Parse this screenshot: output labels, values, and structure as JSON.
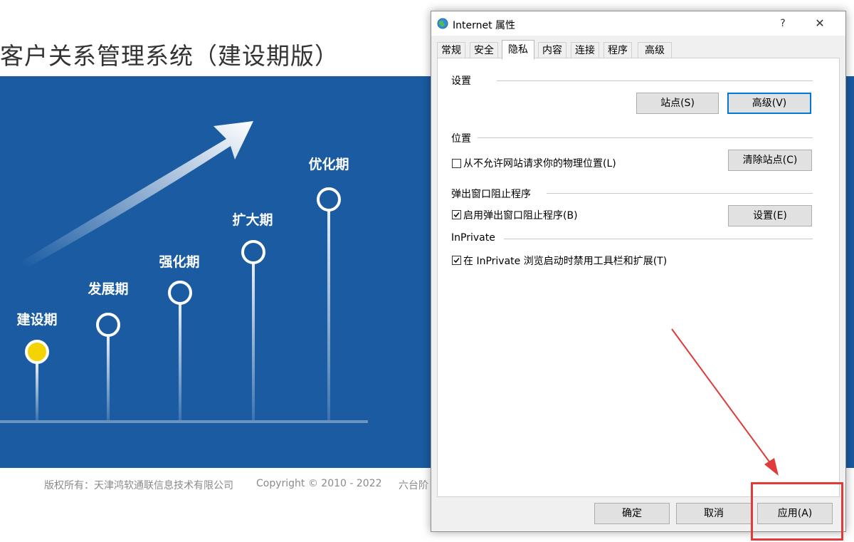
{
  "page": {
    "title": "客户关系管理系统（建设期版）",
    "stages": [
      {
        "label": "建设期",
        "current": true
      },
      {
        "label": "发展期",
        "current": false
      },
      {
        "label": "强化期",
        "current": false
      },
      {
        "label": "扩大期",
        "current": false
      },
      {
        "label": "优化期",
        "current": false
      }
    ],
    "footer": {
      "copyright_owner": "版权所有：天津鸿软通联信息技术有限公司",
      "copyright_years": "Copyright © 2010 - 2022",
      "truncated": "六台阶"
    },
    "colors": {
      "banner": "#1a5ba2",
      "current_stage": "#f4d400"
    }
  },
  "dialog": {
    "title": "Internet 属性",
    "help_label": "?",
    "close_label": "✕",
    "tabs": [
      "常规",
      "安全",
      "隐私",
      "内容",
      "连接",
      "程序",
      "高级"
    ],
    "active_tab": "隐私",
    "settings": {
      "heading": "设置",
      "sites_button": "站点(S)",
      "advanced_button": "高级(V)"
    },
    "location": {
      "heading": "位置",
      "never_allow_label": "从不允许网站请求你的物理位置(L)",
      "never_allow_checked": false,
      "clear_sites_button": "清除站点(C)"
    },
    "popup_blocker": {
      "heading": "弹出窗口阻止程序",
      "enable_label": "启用弹出窗口阻止程序(B)",
      "enable_checked": true,
      "settings_button": "设置(E)"
    },
    "inprivate": {
      "heading": "InPrivate",
      "disable_toolbars_label": "在 InPrivate 浏览启动时禁用工具栏和扩展(T)",
      "disable_toolbars_checked": true
    },
    "footer_buttons": {
      "ok": "确定",
      "cancel": "取消",
      "apply": "应用(A)"
    }
  },
  "annotation": {
    "color": "#e03a3a"
  }
}
